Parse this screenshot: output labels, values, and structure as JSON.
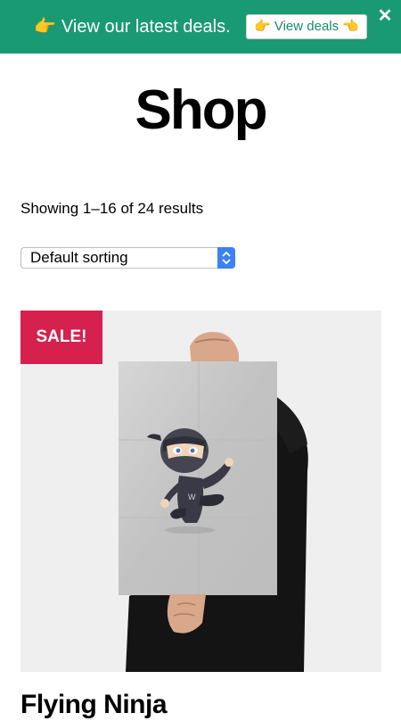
{
  "banner": {
    "icon": "pointing-right-hand-emoji",
    "message": "View our latest deals.",
    "button_label": "View deals",
    "close_icon": "close-icon",
    "background_color": "#1a9a72"
  },
  "page": {
    "title": "Shop"
  },
  "results": {
    "count_text": "Showing 1–16 of 24 results"
  },
  "sorting": {
    "selected": "Default sorting"
  },
  "product": {
    "badge": "SALE!",
    "badge_color": "#d6204e",
    "name": "Flying Ninja",
    "image_icon": "ninja-poster-image"
  }
}
